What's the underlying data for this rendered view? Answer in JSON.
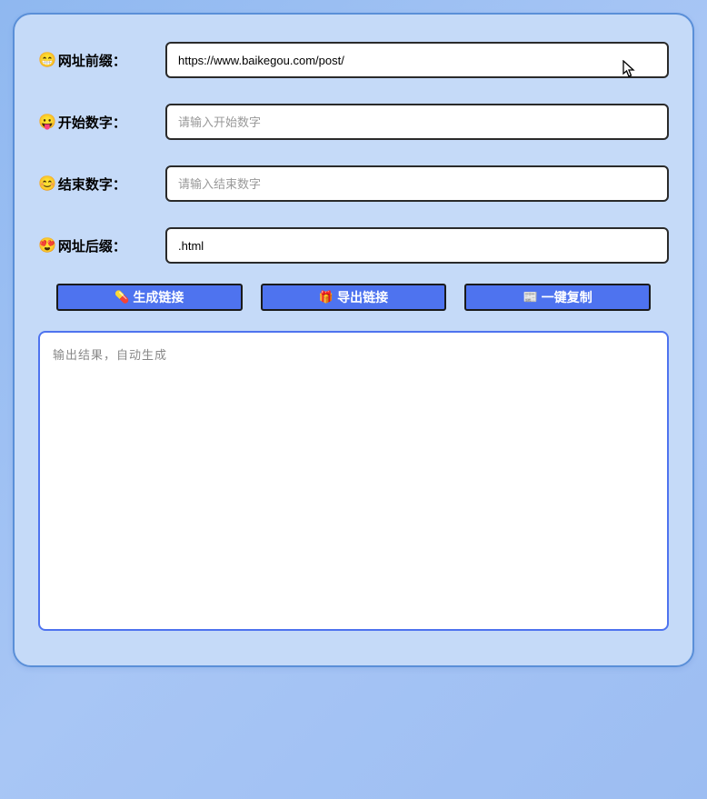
{
  "fields": {
    "prefix": {
      "icon": "😁",
      "label": "网址前缀：",
      "value": "https://www.baikegou.com/post/",
      "placeholder": ""
    },
    "start": {
      "icon": "😛",
      "label": "开始数字：",
      "value": "",
      "placeholder": "请输入开始数字"
    },
    "end": {
      "icon": "😊",
      "label": "结束数字：",
      "value": "",
      "placeholder": "请输入结束数字"
    },
    "suffix": {
      "icon": "😍",
      "label": "网址后缀：",
      "value": ".html",
      "placeholder": ""
    }
  },
  "buttons": {
    "generate": {
      "icon": "💊",
      "label": "生成链接"
    },
    "export": {
      "icon": "🎁",
      "label": "导出链接"
    },
    "copy": {
      "icon": "📰",
      "label": "一键复制"
    }
  },
  "output": {
    "value": "",
    "placeholder": "输出结果，自动生成"
  }
}
